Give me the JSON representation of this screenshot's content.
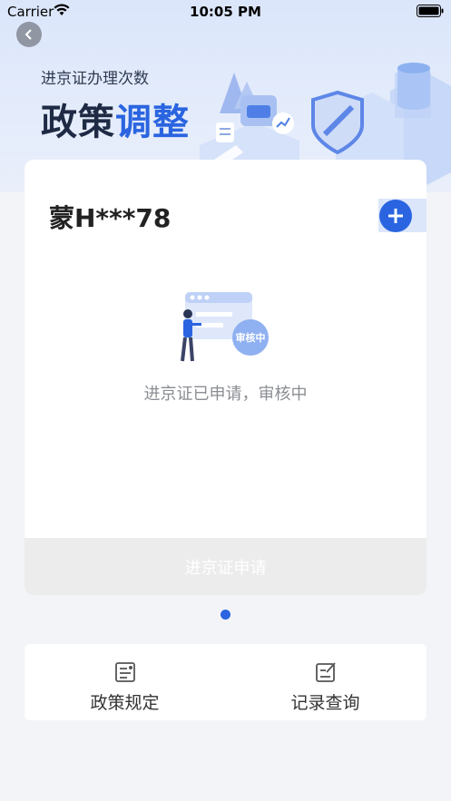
{
  "status_bar": {
    "carrier": "Carrier",
    "time": "10:05 PM"
  },
  "header": {
    "subtitle": "进京证办理次数",
    "headline_main": "政策",
    "headline_accent": "调整"
  },
  "card": {
    "plate": "蒙H***78",
    "badge_text": "审核中",
    "status_text": "进京证已申请，审核中",
    "apply_button": "进京证申请"
  },
  "bottom_nav": [
    {
      "label": "政策规定",
      "icon": "document-list-icon"
    },
    {
      "label": "记录查询",
      "icon": "edit-record-icon"
    }
  ],
  "colors": {
    "accent": "#2a64e0",
    "background": "#f3f4f8"
  }
}
